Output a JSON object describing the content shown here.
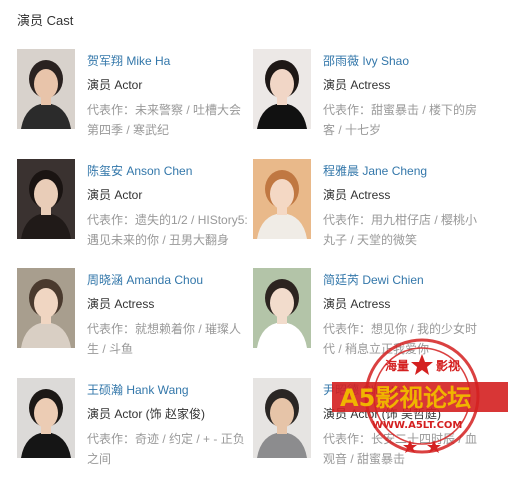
{
  "section_title": "演员 Cast",
  "cast": [
    {
      "name": "贺军翔 Mike Ha",
      "role": "演员 Actor",
      "works_prefix": "代表作：",
      "works": "未来警察 / 吐槽大会第四季 / 寒武纪",
      "photo_bg": "#d8d2cc",
      "hair": "#2a2220",
      "skin": "#e8c4aa",
      "cloth": "#2b2b2b"
    },
    {
      "name": "邵雨薇 Ivy Shao",
      "role": "演员 Actress",
      "works_prefix": "代表作：",
      "works": "甜蜜暴击 / 楼下的房客 / 十七岁",
      "photo_bg": "#ece8e6",
      "hair": "#1e1816",
      "skin": "#f1d6c6",
      "cloth": "#111111"
    },
    {
      "name": "陈玺安 Anson Chen",
      "role": "演员 Actor",
      "works_prefix": "代表作：",
      "works": "遗失的1/2 / HIStory5: 遇见未来的你 / 丑男大翻身",
      "photo_bg": "#3a3230",
      "hair": "#1a1412",
      "skin": "#e9cdb8",
      "cloth": "#201a18"
    },
    {
      "name": "程雅晨 Jane Cheng",
      "role": "演员 Actress",
      "works_prefix": "代表作：",
      "works": "用九柑仔店 / 樱桃小丸子 / 天堂的微笑",
      "photo_bg": "#e9b98a",
      "hair": "#c07842",
      "skin": "#f4d8c4",
      "cloth": "#f0ece6"
    },
    {
      "name": "周晓涵 Amanda Chou",
      "role": "演员 Actress",
      "works_prefix": "代表作：",
      "works": "就想赖着你 / 璀璨人生 / 斗鱼",
      "photo_bg": "#a89e8e",
      "hair": "#4a3a2e",
      "skin": "#f0d6c2",
      "cloth": "#d9cfc4"
    },
    {
      "name": "简廷芮 Dewi Chien",
      "role": "演员 Actress",
      "works_prefix": "代表作：",
      "works": "想见你 / 我的少女时代 / 稍息立正我爱你",
      "photo_bg": "#b3c4a8",
      "hair": "#2c2420",
      "skin": "#f2dccc",
      "cloth": "#ffffff"
    },
    {
      "name": "王硕瀚 Hank Wang",
      "role": "演员 Actor (饰 赵家俊)",
      "works_prefix": "代表作：",
      "works": "奇迹 / 约定 / + - 正负之间",
      "photo_bg": "#dcdad8",
      "hair": "#1c1816",
      "skin": "#ecccb4",
      "cloth": "#151515"
    },
    {
      "name": "尹昭德 Chaote Yin",
      "role": "演员 Actor (饰 吴哲庭)",
      "works_prefix": "代表作：",
      "works": "长安二十四时辰 / 血观音 / 甜蜜暴击",
      "photo_bg": "#e6e4e2",
      "hair": "#2a2624",
      "skin": "#e6c4a8",
      "cloth": "#8c8c8e"
    }
  ],
  "watermark": {
    "brand": "A5影视论坛",
    "top_text": "海量",
    "top_text2": "影视",
    "url": "WWW.A5LT.COM",
    "stamp_color": "#d42020",
    "brand_color": "#f0b400"
  }
}
